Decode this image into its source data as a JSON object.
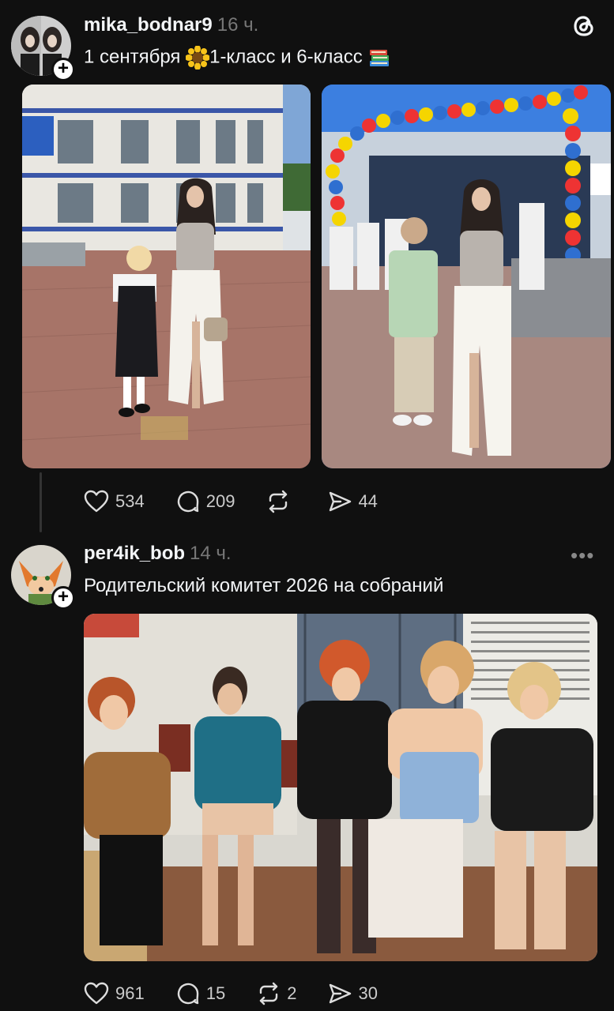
{
  "posts": [
    {
      "username": "mika_bodnar9",
      "time": "16 ч.",
      "caption_part1": "1 сентября ",
      "caption_part2": "1-класс и 6-класс ",
      "likes": "534",
      "comments": "209",
      "reposts": "",
      "shares": "44"
    },
    {
      "username": "per4ik_bob",
      "time": "14 ч.",
      "caption": "Родительский комитет 2026 на собраний",
      "likes": "961",
      "comments": "15",
      "reposts": "2",
      "shares": "30",
      "more": "•••"
    }
  ],
  "icons": {
    "logo": "threads-logo-icon",
    "like": "heart-icon",
    "comment": "comment-icon",
    "repost": "repost-icon",
    "share": "share-icon",
    "sunflower": "sunflower-emoji-icon",
    "books": "books-emoji-icon"
  },
  "colors": {
    "background": "#101010",
    "text": "#f3f5f7",
    "muted": "#777777"
  }
}
